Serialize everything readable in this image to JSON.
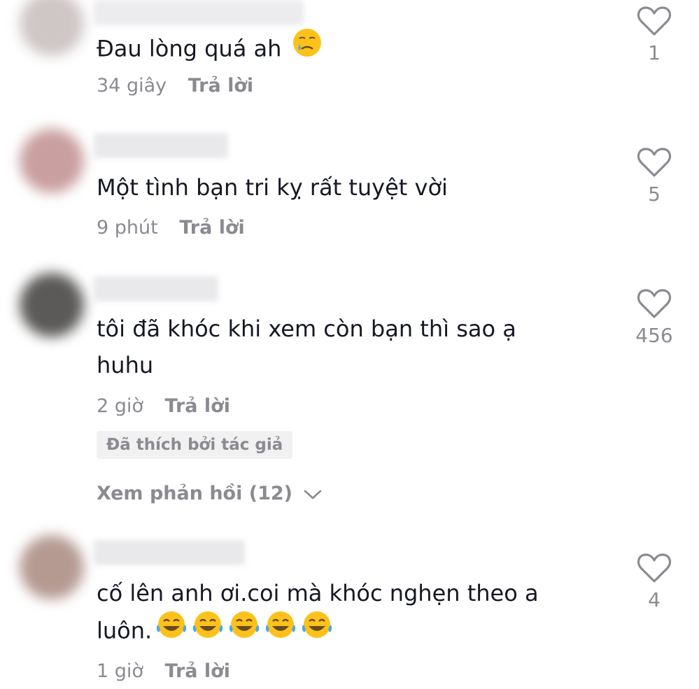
{
  "comments": [
    {
      "text": "Đau lòng quá ah",
      "emoji": "crying-face",
      "time": "34 giây",
      "reply_label": "Trả lời",
      "likes": "1"
    },
    {
      "text": "Một tình bạn tri kỵ rất tuyệt vời",
      "time": "9 phút",
      "reply_label": "Trả lời",
      "likes": "5"
    },
    {
      "text_line1": "tôi đã khóc khi xem còn bạn thì sao ạ",
      "text_line2": "huhu",
      "time": "2 giờ",
      "reply_label": "Trả lời",
      "likes": "456",
      "author_liked_label": "Đã thích bởi tác giả",
      "view_replies_label": "Xem phản hồi (12)"
    },
    {
      "text_line1": "cố lên anh ơi.coi mà khóc nghẹn theo a",
      "text_line2": "luôn.",
      "emoji": "tears-of-joy x5",
      "time": "1 giờ",
      "reply_label": "Trả lời",
      "likes": "4"
    }
  ],
  "colors": {
    "text": "#161823",
    "secondary": "#8a8b91",
    "badge_bg": "#f1f1f2"
  }
}
